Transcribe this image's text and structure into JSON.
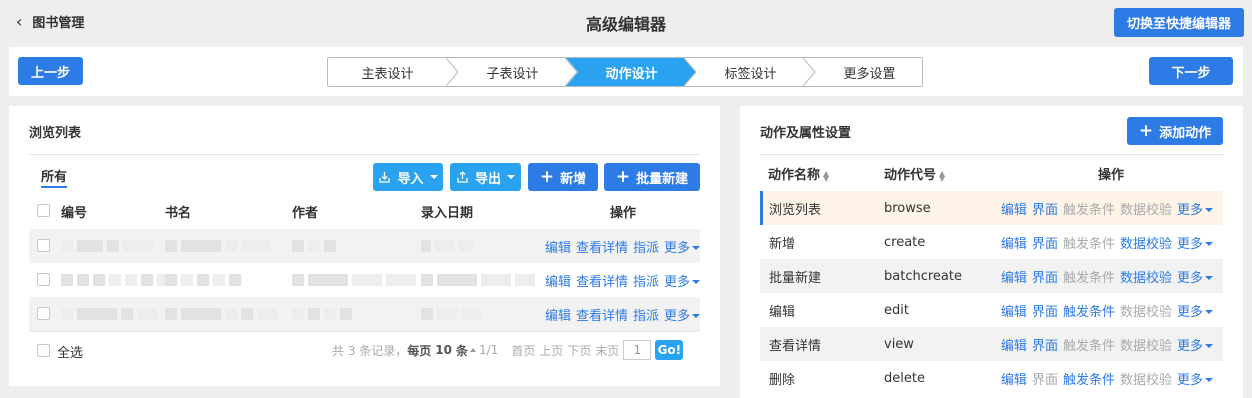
{
  "header": {
    "back_label": "图书管理",
    "title": "高级编辑器",
    "switch_label": "切换至快捷编辑器"
  },
  "wizard": {
    "prev_label": "上一步",
    "next_label": "下一步",
    "steps": [
      "主表设计",
      "子表设计",
      "动作设计",
      "标签设计",
      "更多设置"
    ],
    "active_step": 2
  },
  "colors": {
    "primary": "#2d7be5",
    "light_primary": "#29a3ef",
    "selected_row": "#fdf3e6"
  },
  "browse": {
    "title": "浏览列表",
    "tab": "所有",
    "import_label": "导入",
    "export_label": "导出",
    "add_label": "新增",
    "batch_add_label": "批量新建",
    "columns": [
      "编号",
      "书名",
      "作者",
      "录入日期",
      "操作"
    ],
    "row_ops": [
      "编辑",
      "查看详情",
      "指派",
      "更多"
    ],
    "select_all": "全选",
    "pager": {
      "summary": "共 3 条记录，",
      "per_page_prefix": "每页",
      "per_page": "10",
      "per_page_suffix": "条",
      "page": "1/1",
      "first": "首页",
      "prev": "上页",
      "next": "下页",
      "last": "末页",
      "input": "1",
      "go": "Go!"
    }
  },
  "actions": {
    "title": "动作及属性设置",
    "add_label": "添加动作",
    "columns": [
      "动作名称",
      "动作代号",
      "操作"
    ],
    "rows": [
      {
        "name": "浏览列表",
        "code": "browse",
        "enabled": [
          true,
          true,
          false,
          false
        ]
      },
      {
        "name": "新增",
        "code": "create",
        "enabled": [
          true,
          true,
          false,
          true
        ]
      },
      {
        "name": "批量新建",
        "code": "batchcreate",
        "enabled": [
          true,
          true,
          false,
          true
        ]
      },
      {
        "name": "编辑",
        "code": "edit",
        "enabled": [
          true,
          true,
          true,
          false
        ]
      },
      {
        "name": "查看详情",
        "code": "view",
        "enabled": [
          true,
          true,
          false,
          false
        ]
      },
      {
        "name": "删除",
        "code": "delete",
        "enabled": [
          true,
          false,
          true,
          false
        ]
      }
    ],
    "row_ops": [
      "编辑",
      "界面",
      "触发条件",
      "数据校验",
      "更多"
    ]
  }
}
